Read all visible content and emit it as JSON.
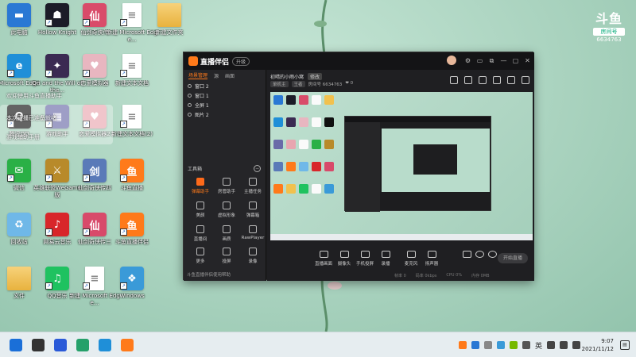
{
  "desktop": {
    "icons": [
      {
        "label": "此电脑",
        "color": "#2a78d4",
        "kind": "pc",
        "glyph": "▬"
      },
      {
        "label": "Hollow Knight",
        "color": "#1c1c28",
        "kind": "game",
        "glyph": "☗"
      },
      {
        "label": "仙剑奇侠传",
        "color": "#d94c6a",
        "kind": "game",
        "glyph": "仙"
      },
      {
        "label": "新建 Microsoft Edge...",
        "color": "#ffffff",
        "kind": "doc",
        "glyph": "≡"
      },
      {
        "label": "新建文件夹",
        "color": "#f1c14e",
        "kind": "folder",
        "glyph": ""
      },
      {
        "label": "Microsoft Edge",
        "color": "#1f8fd8",
        "kind": "app",
        "glyph": "e"
      },
      {
        "label": "Ori and the Will of the...",
        "color": "#3b2a52",
        "kind": "game",
        "glyph": "✦"
      },
      {
        "label": "恋爱模拟器",
        "color": "#e8b6c0",
        "kind": "game",
        "glyph": "♥"
      },
      {
        "label": "新建文本文档",
        "color": "#ffffff",
        "kind": "doc",
        "glyph": "≡"
      },
      {
        "label": "腾讯QQ",
        "color": "#111111",
        "kind": "app",
        "glyph": "Q"
      },
      {
        "label": "游戏助手",
        "color": "#6a6aa8",
        "kind": "game",
        "glyph": "▦"
      },
      {
        "label": "恋爱模拟器2",
        "color": "#e8a6b0",
        "kind": "game",
        "glyph": "♥"
      },
      {
        "label": "新建文本文档(2)",
        "color": "#ffffff",
        "kind": "doc",
        "glyph": "≡"
      },
      {
        "label": "微信",
        "color": "#2ab046",
        "kind": "app",
        "glyph": "✉"
      },
      {
        "label": "英雄联盟WeGame版",
        "color": "#b88a2a",
        "kind": "game",
        "glyph": "⚔"
      },
      {
        "label": "仙剑奇侠传四",
        "color": "#5a7ab8",
        "kind": "game",
        "glyph": "剑"
      },
      {
        "label": "斗鱼直播",
        "color": "#ff7a1a",
        "kind": "app",
        "glyph": "鱼"
      },
      {
        "label": "回收站",
        "color": "#6fb8e8",
        "kind": "app",
        "glyph": "♻"
      },
      {
        "label": "网易云音乐",
        "color": "#d8262a",
        "kind": "app",
        "glyph": "♪"
      },
      {
        "label": "仙剑奇侠传三",
        "color": "#d84a6a",
        "kind": "game",
        "glyph": "仙"
      },
      {
        "label": "斗鱼直播伴侣",
        "color": "#ff7a1a",
        "kind": "app",
        "glyph": "鱼"
      },
      {
        "label": "文件",
        "color": "#f1c14e",
        "kind": "folder",
        "glyph": ""
      },
      {
        "label": "QQ音乐",
        "color": "#1fc260",
        "kind": "app",
        "glyph": "♫"
      },
      {
        "label": "新建 Microsoft Edge...",
        "color": "#ffffff",
        "kind": "doc",
        "glyph": "≡"
      },
      {
        "label": "Windows",
        "color": "#3a9ad8",
        "kind": "app",
        "glyph": "❖"
      }
    ],
    "popup_lines": [
      "欢迎使用斗鱼直播助手",
      "本次直播已准备就绪",
      "游戏辅助手册"
    ],
    "watermark": {
      "brand": "斗鱼",
      "badge": "房间号",
      "room": "6634763"
    }
  },
  "app": {
    "name": "直播伴侣",
    "tag": "升级",
    "window_controls": [
      "⚙",
      "▭",
      "⧉",
      "—",
      "▢",
      "✕"
    ],
    "scene_tabs": [
      "场景管理",
      "源",
      "画面"
    ],
    "scenes": [
      "窗口 2",
      "窗口 1",
      "全屏 1",
      "图片 2"
    ],
    "tools_title": "工具箱",
    "tools": [
      "弹幕助手",
      "房管助手",
      "主播任务",
      "美颜",
      "虚拟形象",
      "弹幕箱",
      "直播间",
      "画质",
      "RawPlayer",
      "更多",
      "投屏",
      "录像"
    ],
    "left_footer": "斗鱼直播伴侣使用帮助",
    "room_title": "初晴的小雨小窝",
    "room_edit": "修改",
    "room_sub": [
      "单机主",
      "王者",
      "房间号 6634763",
      "❤ 0"
    ],
    "bottom_buttons": [
      "直播画面",
      "摄像头",
      "手机投屏",
      "录播",
      "麦克风",
      "扬声器"
    ],
    "go_live": "开始直播",
    "stats": [
      "帧率 0",
      "码率 0kbps",
      "CPU 0%",
      "内存 0MB"
    ]
  },
  "taskbar": {
    "apps": [
      {
        "name": "start",
        "color": "#1a6fd8"
      },
      {
        "name": "task-view",
        "color": "#333333"
      },
      {
        "name": "nk",
        "color": "#2a5ad8"
      },
      {
        "name": "store",
        "color": "#25a06a"
      },
      {
        "name": "edge",
        "color": "#1f8fd8"
      },
      {
        "name": "douyu",
        "color": "#ff7a1a"
      }
    ],
    "tray_lang": "英",
    "time": "9:07",
    "date": "2021/11/12"
  }
}
